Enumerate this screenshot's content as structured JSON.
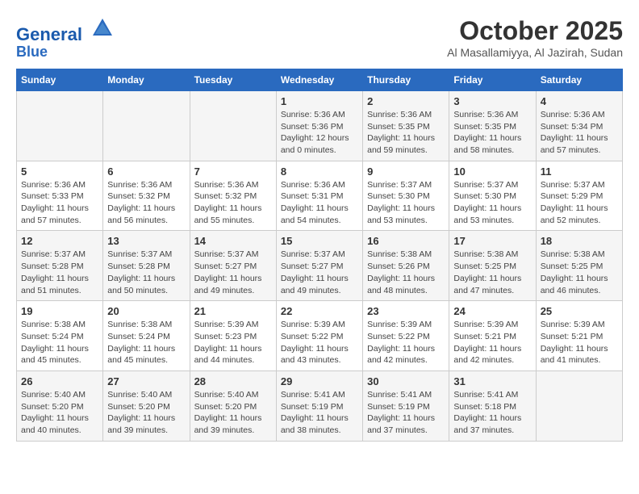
{
  "header": {
    "logo_line1": "General",
    "logo_line2": "Blue",
    "month": "October 2025",
    "location": "Al Masallamiyya, Al Jazirah, Sudan"
  },
  "weekdays": [
    "Sunday",
    "Monday",
    "Tuesday",
    "Wednesday",
    "Thursday",
    "Friday",
    "Saturday"
  ],
  "weeks": [
    [
      {
        "day": "",
        "info": ""
      },
      {
        "day": "",
        "info": ""
      },
      {
        "day": "",
        "info": ""
      },
      {
        "day": "1",
        "info": "Sunrise: 5:36 AM\nSunset: 5:36 PM\nDaylight: 12 hours\nand 0 minutes."
      },
      {
        "day": "2",
        "info": "Sunrise: 5:36 AM\nSunset: 5:35 PM\nDaylight: 11 hours\nand 59 minutes."
      },
      {
        "day": "3",
        "info": "Sunrise: 5:36 AM\nSunset: 5:35 PM\nDaylight: 11 hours\nand 58 minutes."
      },
      {
        "day": "4",
        "info": "Sunrise: 5:36 AM\nSunset: 5:34 PM\nDaylight: 11 hours\nand 57 minutes."
      }
    ],
    [
      {
        "day": "5",
        "info": "Sunrise: 5:36 AM\nSunset: 5:33 PM\nDaylight: 11 hours\nand 57 minutes."
      },
      {
        "day": "6",
        "info": "Sunrise: 5:36 AM\nSunset: 5:32 PM\nDaylight: 11 hours\nand 56 minutes."
      },
      {
        "day": "7",
        "info": "Sunrise: 5:36 AM\nSunset: 5:32 PM\nDaylight: 11 hours\nand 55 minutes."
      },
      {
        "day": "8",
        "info": "Sunrise: 5:36 AM\nSunset: 5:31 PM\nDaylight: 11 hours\nand 54 minutes."
      },
      {
        "day": "9",
        "info": "Sunrise: 5:37 AM\nSunset: 5:30 PM\nDaylight: 11 hours\nand 53 minutes."
      },
      {
        "day": "10",
        "info": "Sunrise: 5:37 AM\nSunset: 5:30 PM\nDaylight: 11 hours\nand 53 minutes."
      },
      {
        "day": "11",
        "info": "Sunrise: 5:37 AM\nSunset: 5:29 PM\nDaylight: 11 hours\nand 52 minutes."
      }
    ],
    [
      {
        "day": "12",
        "info": "Sunrise: 5:37 AM\nSunset: 5:28 PM\nDaylight: 11 hours\nand 51 minutes."
      },
      {
        "day": "13",
        "info": "Sunrise: 5:37 AM\nSunset: 5:28 PM\nDaylight: 11 hours\nand 50 minutes."
      },
      {
        "day": "14",
        "info": "Sunrise: 5:37 AM\nSunset: 5:27 PM\nDaylight: 11 hours\nand 49 minutes."
      },
      {
        "day": "15",
        "info": "Sunrise: 5:37 AM\nSunset: 5:27 PM\nDaylight: 11 hours\nand 49 minutes."
      },
      {
        "day": "16",
        "info": "Sunrise: 5:38 AM\nSunset: 5:26 PM\nDaylight: 11 hours\nand 48 minutes."
      },
      {
        "day": "17",
        "info": "Sunrise: 5:38 AM\nSunset: 5:25 PM\nDaylight: 11 hours\nand 47 minutes."
      },
      {
        "day": "18",
        "info": "Sunrise: 5:38 AM\nSunset: 5:25 PM\nDaylight: 11 hours\nand 46 minutes."
      }
    ],
    [
      {
        "day": "19",
        "info": "Sunrise: 5:38 AM\nSunset: 5:24 PM\nDaylight: 11 hours\nand 45 minutes."
      },
      {
        "day": "20",
        "info": "Sunrise: 5:38 AM\nSunset: 5:24 PM\nDaylight: 11 hours\nand 45 minutes."
      },
      {
        "day": "21",
        "info": "Sunrise: 5:39 AM\nSunset: 5:23 PM\nDaylight: 11 hours\nand 44 minutes."
      },
      {
        "day": "22",
        "info": "Sunrise: 5:39 AM\nSunset: 5:22 PM\nDaylight: 11 hours\nand 43 minutes."
      },
      {
        "day": "23",
        "info": "Sunrise: 5:39 AM\nSunset: 5:22 PM\nDaylight: 11 hours\nand 42 minutes."
      },
      {
        "day": "24",
        "info": "Sunrise: 5:39 AM\nSunset: 5:21 PM\nDaylight: 11 hours\nand 42 minutes."
      },
      {
        "day": "25",
        "info": "Sunrise: 5:39 AM\nSunset: 5:21 PM\nDaylight: 11 hours\nand 41 minutes."
      }
    ],
    [
      {
        "day": "26",
        "info": "Sunrise: 5:40 AM\nSunset: 5:20 PM\nDaylight: 11 hours\nand 40 minutes."
      },
      {
        "day": "27",
        "info": "Sunrise: 5:40 AM\nSunset: 5:20 PM\nDaylight: 11 hours\nand 39 minutes."
      },
      {
        "day": "28",
        "info": "Sunrise: 5:40 AM\nSunset: 5:20 PM\nDaylight: 11 hours\nand 39 minutes."
      },
      {
        "day": "29",
        "info": "Sunrise: 5:41 AM\nSunset: 5:19 PM\nDaylight: 11 hours\nand 38 minutes."
      },
      {
        "day": "30",
        "info": "Sunrise: 5:41 AM\nSunset: 5:19 PM\nDaylight: 11 hours\nand 37 minutes."
      },
      {
        "day": "31",
        "info": "Sunrise: 5:41 AM\nSunset: 5:18 PM\nDaylight: 11 hours\nand 37 minutes."
      },
      {
        "day": "",
        "info": ""
      }
    ]
  ]
}
